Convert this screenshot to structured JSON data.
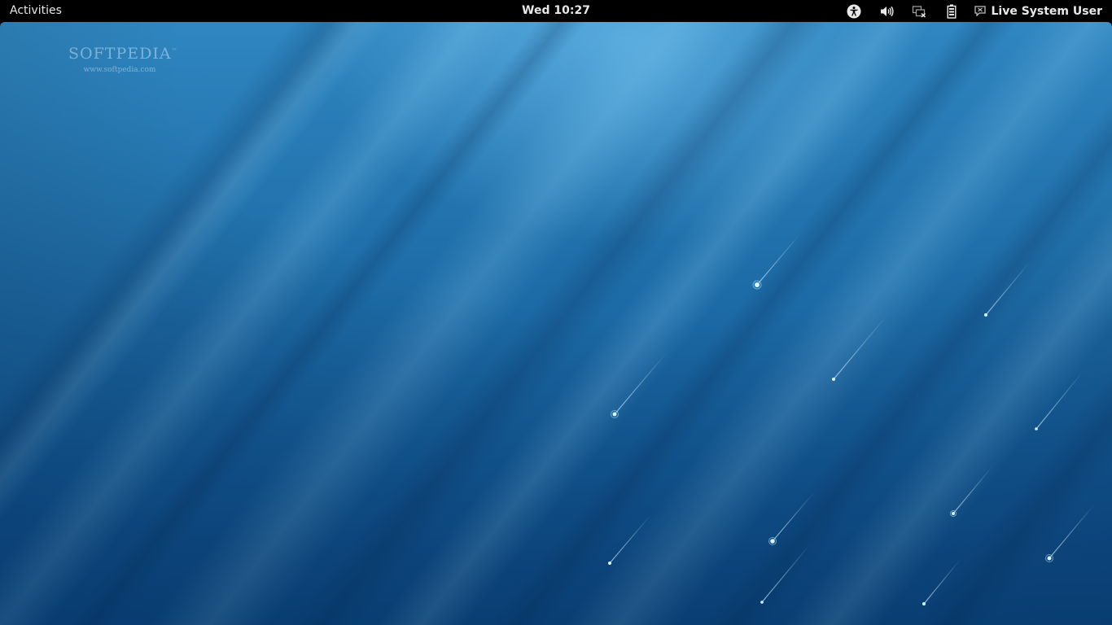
{
  "top_bar": {
    "activities_label": "Activities",
    "clock": "Wed 10:27",
    "status_icons": [
      "accessibility-icon",
      "volume-icon",
      "network-icon",
      "battery-icon"
    ],
    "user_name": "Live System User",
    "user_status_icon": "chat-status-icon"
  },
  "desktop": {
    "watermark_title": "SOFTPEDIA",
    "watermark_trademark": "™",
    "watermark_url": "www.softpedia.com"
  },
  "colors": {
    "top_bar": "#000000",
    "top_bar_text": "#e8e8e8",
    "wallpaper_light": "#5fb6e8",
    "wallpaper_mid": "#1f6ea9",
    "wallpaper_dark": "#0c4d8c"
  }
}
